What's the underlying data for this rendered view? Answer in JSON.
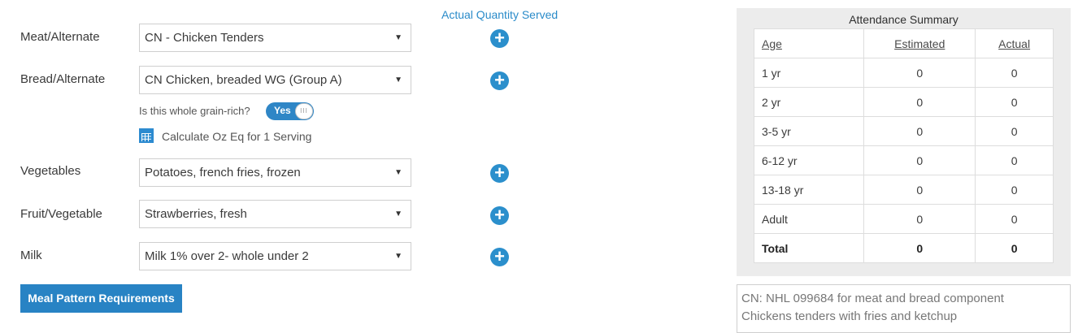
{
  "quantity_header": "Actual Quantity Served",
  "rows": [
    {
      "label": "Meat/Alternate",
      "selected": "CN - Chicken Tenders"
    },
    {
      "label": "Bread/Alternate",
      "selected": "CN Chicken, breaded WG (Group A)"
    },
    {
      "label": "Vegetables",
      "selected": "Potatoes, french fries, frozen"
    },
    {
      "label": "Fruit/Vegetable",
      "selected": "Strawberries, fresh"
    },
    {
      "label": "Milk",
      "selected": "Milk 1% over 2- whole under 2"
    }
  ],
  "whole_grain": {
    "question": "Is this whole grain-rich?",
    "toggle_label": "Yes",
    "toggle_state": "on",
    "knob_glyph": "III"
  },
  "calculate_link": "Calculate Oz Eq for 1 Serving",
  "meal_pattern_button": "Meal Pattern Requirements",
  "attendance": {
    "title": "Attendance Summary",
    "columns": [
      "Age",
      "Estimated",
      "Actual"
    ],
    "rows": [
      {
        "age": "1 yr",
        "estimated": "0",
        "actual": "0"
      },
      {
        "age": "2 yr",
        "estimated": "0",
        "actual": "0"
      },
      {
        "age": "3-5 yr",
        "estimated": "0",
        "actual": "0"
      },
      {
        "age": "6-12 yr",
        "estimated": "0",
        "actual": "0"
      },
      {
        "age": "13-18 yr",
        "estimated": "0",
        "actual": "0"
      },
      {
        "age": "Adult",
        "estimated": "0",
        "actual": "0"
      }
    ],
    "total": {
      "label": "Total",
      "estimated": "0",
      "actual": "0"
    }
  },
  "notes": {
    "line1": "CN: NHL 099684 for meat and bread component",
    "line2": "Chickens tenders with fries and ketchup"
  },
  "icons": {
    "add": "plus-circle-icon",
    "calculator": "calculator-icon",
    "dropdown": "dropdown-arrow-icon"
  },
  "colors": {
    "accent": "#2b8fcc",
    "button": "#2883c4",
    "panel_bg": "#ececec"
  }
}
